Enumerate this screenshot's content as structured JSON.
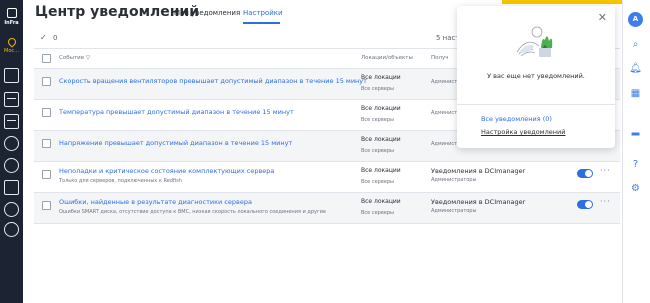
{
  "sidebar_left": {
    "logo_text": "InFra",
    "location_label": "Мос...",
    "icons": [
      "dashboard-icon",
      "layers-icon",
      "server-icon",
      "power-icon",
      "network-icon",
      "storage-icon",
      "user-icon"
    ]
  },
  "header": {
    "title": "Центр уведомлений",
    "tabs": [
      "Мои уведомления",
      "Настройки"
    ],
    "active_tab": "Настройки"
  },
  "toolbar": {
    "selected_count": "0",
    "settings_count": "5 наст"
  },
  "table": {
    "columns": [
      "Событие",
      "Локации/объекты",
      "Получ"
    ],
    "rows": [
      {
        "event": "Скорость вращения вентиляторов превышает допустимый диапазон в течение 15 минут",
        "sub": "",
        "locations": "Все локации",
        "servers": "Все серверы",
        "recipient": "",
        "recipient_sub": "Администраторы",
        "enabled": false
      },
      {
        "event": "Температура превышает допустимый диапазон в течение 15 минут",
        "sub": "",
        "locations": "Все локации",
        "servers": "Все серверы",
        "recipient": "",
        "recipient_sub": "Администраторы",
        "enabled": false
      },
      {
        "event": "Напряжение превышает допустимый диапазон в течение 15 минут",
        "sub": "",
        "locations": "Все локации",
        "servers": "Все серверы",
        "recipient": "",
        "recipient_sub": "Администраторы",
        "enabled": false
      },
      {
        "event": "Неполадки и критическое состояние комплектующих сервера",
        "sub": "Только для серверов, подключенных к Redfish",
        "locations": "Все локации",
        "servers": "Все серверы",
        "recipient": "Уведомления в DCImanager",
        "recipient_sub": "Администраторы",
        "enabled": true
      },
      {
        "event": "Ошибки, найденные в результате диагностики сервера",
        "sub": "Ошибки SMART диска, отсутствие доступа к BMC, низкая скорость локального соединения и другие",
        "locations": "Все локации",
        "servers": "Все серверы",
        "recipient": "Уведомления в DCImanager",
        "recipient_sub": "Администраторы",
        "enabled": true
      }
    ]
  },
  "popover": {
    "empty_text": "У вас еще нет уведомлений.",
    "all_link": "Все уведомления (0)",
    "settings_link": "Настройка уведомлений"
  },
  "sidebar_right": {
    "avatar_letter": "A",
    "accent_color": "#3f7de8"
  },
  "colors": {
    "link": "#2d6ee0",
    "sidebar_bg": "#1c2333",
    "location_accent": "#f4b400",
    "header_accent": "#f7c400"
  }
}
